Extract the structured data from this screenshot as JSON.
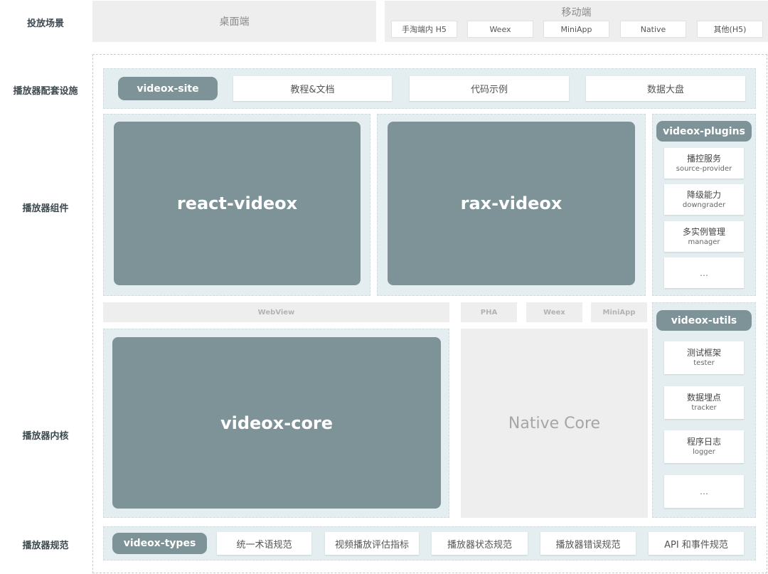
{
  "rows": {
    "scenario": "投放场景",
    "infra": "播放器配套设施",
    "components": "播放器组件",
    "kernel": "播放器内核",
    "spec": "播放器规范"
  },
  "scenario": {
    "desktop": "桌面端",
    "mobile": "移动端",
    "mobile_items": [
      "手淘端内 H5",
      "Weex",
      "MiniApp",
      "Native",
      "其他(H5)"
    ]
  },
  "infra": {
    "site": "videox-site",
    "items": [
      "教程&文档",
      "代码示例",
      "数据大盘"
    ]
  },
  "components": {
    "react": "react-videox",
    "rax": "rax-videox",
    "plugins": {
      "title": "videox-plugins",
      "items": [
        {
          "zh": "播控服务",
          "en": "source-provider"
        },
        {
          "zh": "降级能力",
          "en": "downgrader"
        },
        {
          "zh": "多实例管理",
          "en": "manager"
        }
      ],
      "more": "…"
    }
  },
  "runtime": {
    "webview": "WebView",
    "pha": "PHA",
    "weex": "Weex",
    "miniapp": "MiniApp"
  },
  "kernel": {
    "core": "videox-core",
    "native": "Native Core",
    "utils": {
      "title": "videox-utils",
      "items": [
        {
          "zh": "测试框架",
          "en": "tester"
        },
        {
          "zh": "数据埋点",
          "en": "tracker"
        },
        {
          "zh": "程序日志",
          "en": "logger"
        }
      ],
      "more": "…"
    }
  },
  "spec": {
    "types": "videox-types",
    "items": [
      "统一术语规范",
      "视频播放评估指标",
      "播放器状态规范",
      "播放器错误规范",
      "API 和事件规范"
    ]
  },
  "colors": {
    "pill": "#7e9397",
    "panel": "#e4edef",
    "band": "#eeeeee"
  }
}
